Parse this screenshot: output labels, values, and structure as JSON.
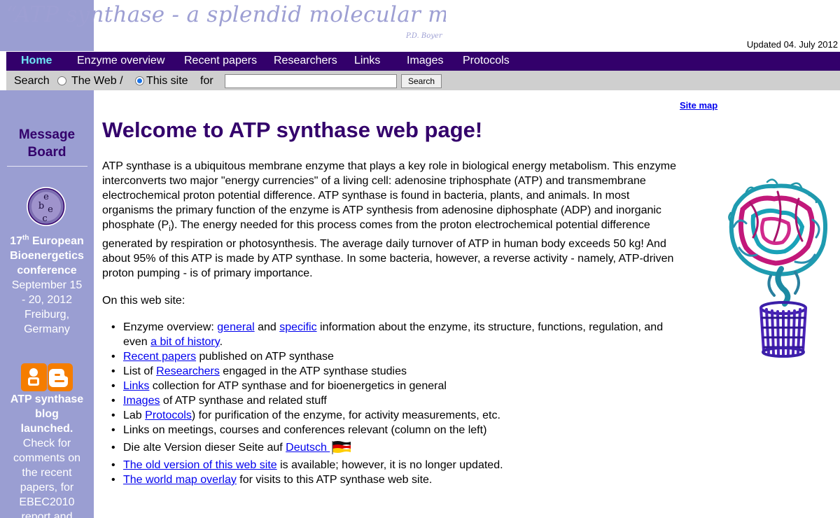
{
  "header": {
    "title": "“ATP synthase - a splendid molecular machine”",
    "author": "P.D. Boyer",
    "updated": "Updated 04. July 2012"
  },
  "nav": {
    "items": [
      "Home",
      "Enzyme overview",
      "Recent papers",
      "Researchers",
      "Links",
      "Images",
      "Protocols"
    ]
  },
  "search": {
    "label": "Search",
    "option_web": "The Web /",
    "option_site": "This site",
    "for_label": "for",
    "value": "",
    "button": "Search",
    "selected": "This site"
  },
  "sidebar": {
    "message_board": [
      "Message",
      "Board"
    ],
    "conference": {
      "logo_letters": [
        "e",
        "b",
        "e",
        "c"
      ],
      "lines": [
        "17th European",
        "Bioenergetics",
        "conference",
        "September 15",
        "- 20, 2012",
        "Freiburg,",
        "Germany"
      ]
    },
    "blog": {
      "lines_bold": [
        "ATP synthase",
        "blog",
        "launched."
      ],
      "lines": [
        "Check for",
        "comments on",
        "the recent",
        "papers, for",
        "EBEC2010",
        "report and"
      ]
    }
  },
  "main": {
    "site_map": "Site map",
    "title": "Welcome to ATP synthase web page!",
    "intro_lines": [
      "ATP synthase is a ubiquitous membrane enzyme that plays a key role in biological energy metabolism. This enzyme",
      "interconverts two major \"energy currencies\" of a living cell: adenosine triphosphate (ATP) and transmembrane",
      "electrochemical proton potential difference. ATP synthase is found in bacteria, plants, and animals. In most",
      "organisms the primary function of the enzyme is ATP synthesis from adenosine diphosphate (ADP) and inorganic",
      "phosphate (P",
      "). The energy needed for this process comes from the proton electrochemical potential difference",
      "generated by respiration or photosynthesis. The average daily turnover of ATP in human body exceeds 50 kg! And",
      "about 95% of this ATP is made by ATP synthase. In some bacteria, however, a reverse activity - namely, ATP-driven",
      "proton pumping - is of primary importance."
    ],
    "subscript_i": "i",
    "on_site": "On this web site:",
    "list": {
      "i0": {
        "a": "Enzyme overview: ",
        "l1": "general",
        "b": " and ",
        "l2": "specific",
        "c": " information about the enzyme, its structure, functions, regulation, and",
        "d": "even ",
        "l3": "a bit of history",
        "e": "."
      },
      "i1": {
        "l": "Recent papers",
        "t": " published on ATP synthase"
      },
      "i2": {
        "p": "List of ",
        "l": "Researchers",
        "t": " engaged in the ATP synthase studies"
      },
      "i3": {
        "l": "Links",
        "t": " collection for ATP synthase and for bioenergetics in general"
      },
      "i4": {
        "l": "Images",
        "t": " of ATP synthase and related stuff"
      },
      "i5": {
        "p": "Lab ",
        "l": "Protocols",
        "t": ") for purification of the enzyme, for activity measurements, etc."
      },
      "i6": {
        "t": "Links on meetings, courses and conferences relevant (column on the left)"
      },
      "i7": {
        "p": "Die alte Version dieser Seite auf ",
        "l": "Deutsch "
      },
      "i8": {
        "l": "The old version of this web site",
        "t": " is available; however, it is no longer updated."
      },
      "i9": {
        "l": "The world map overlay",
        "t": " for visits to this ATP synthase web site."
      }
    }
  },
  "colors": {
    "nav_bg": "#33006b",
    "sidebar_bg": "#9a9ed2",
    "title_color": "#33006b",
    "link": "#0000ee",
    "home_active": "#6fe6f5"
  }
}
